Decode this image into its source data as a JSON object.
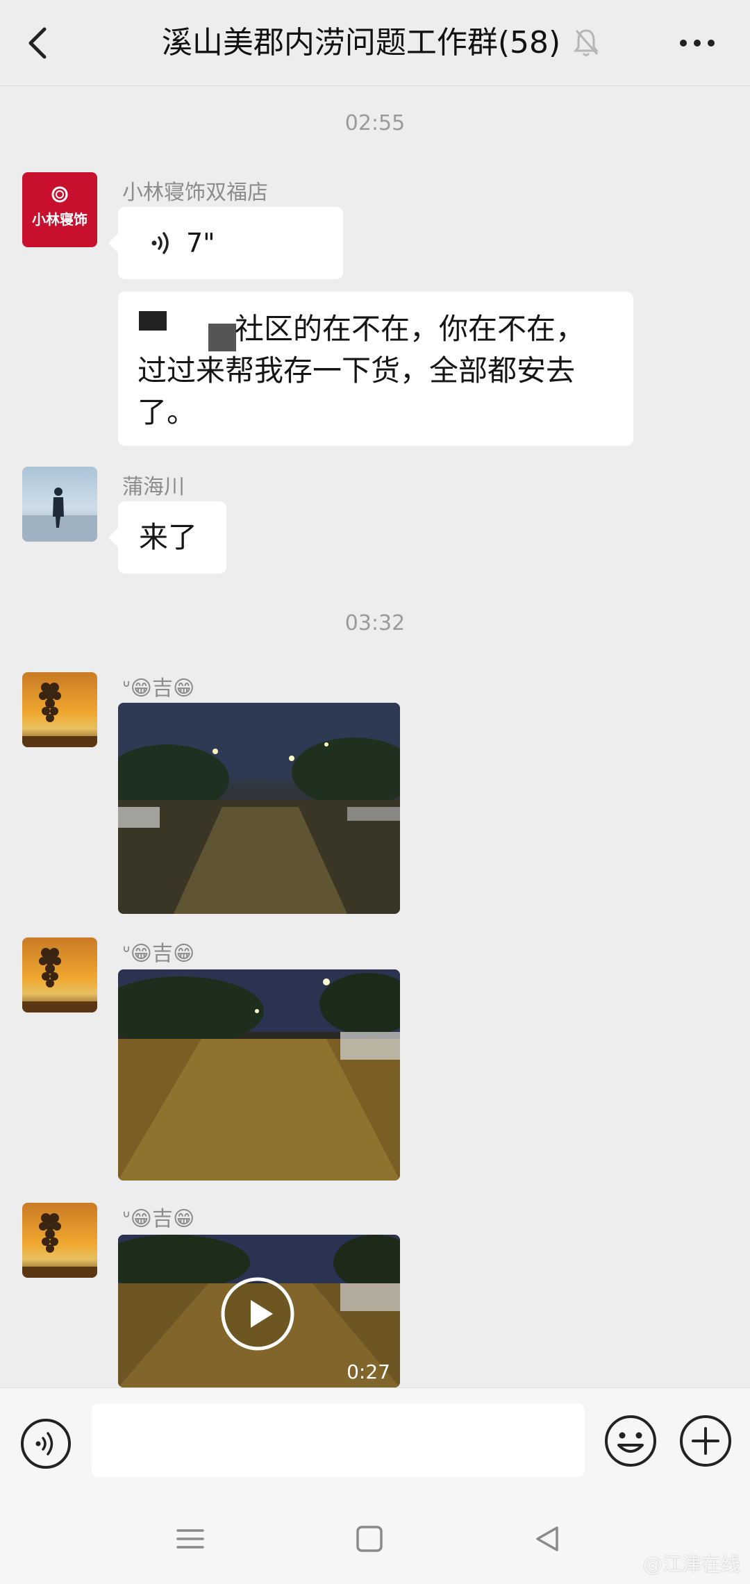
{
  "header": {
    "back_icon": "chevron-left-icon",
    "title": "溪山美郡内涝问题工作群(58)",
    "mute_icon": "bell-muted-icon",
    "more_icon": "more-dots-icon"
  },
  "messages": {
    "time_1": "02:55",
    "msg1": {
      "sender": "小林寝饰双福店",
      "avatar_text": "小林寝饰",
      "voice_duration": "7\"",
      "text_line1": "社区的在不在，你在不在，",
      "text_line2": "过过来帮我存一下货，全部都安去",
      "text_line3": "了。"
    },
    "msg2": {
      "sender": "蒲海川",
      "text": "来了"
    },
    "time_2": "03:32",
    "msg3": {
      "sender": "ᐡ😁吉😁"
    },
    "msg4": {
      "sender": "ᐡ😁吉😁"
    },
    "msg5": {
      "sender": "ᐡ😁吉😁",
      "video_duration": "0:27"
    }
  },
  "input_bar": {
    "voice_icon": "voice-icon",
    "placeholder": "",
    "emoji_icon": "emoji-icon",
    "plus_icon": "plus-icon"
  },
  "nav": {
    "menu_icon": "menu-icon",
    "home_icon": "home-icon",
    "back_icon": "back-triangle-icon"
  },
  "watermark": "@江津在线",
  "colors": {
    "background": "#ededed",
    "bubble": "#ffffff",
    "brand_red": "#c8102e"
  }
}
